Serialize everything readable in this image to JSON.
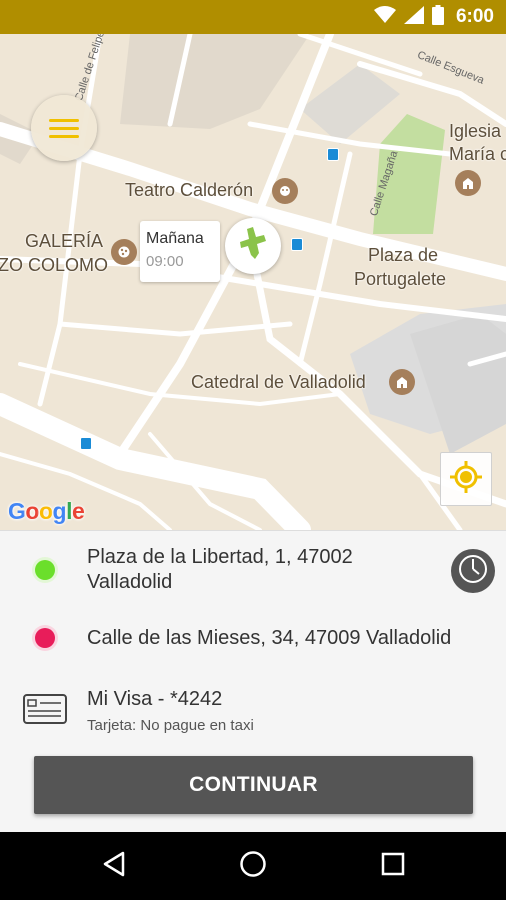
{
  "status_bar": {
    "time": "6:00",
    "icons": [
      "wifi-icon",
      "cell-signal-icon",
      "battery-icon"
    ]
  },
  "map": {
    "labels": {
      "teatro": "Teatro Calderón",
      "galeria_line1": "GALERÍA",
      "galeria_line2": "ZO COLOMO",
      "plaza_line1": "Plaza de",
      "plaza_line2": "Portugalete",
      "catedral": "Catedral de Valladolid",
      "iglesia_line1": "Iglesia",
      "iglesia_line2": "María c"
    },
    "streets": {
      "felipe": "Calle de Felipe II",
      "esgueva": "Calle Esgueva",
      "magana": "Calle Magaña"
    },
    "pickup_bubble": {
      "title": "Mañana",
      "time": "09:00"
    },
    "attribution": {
      "G": "G",
      "o1": "o",
      "o2": "o",
      "g": "g",
      "l": "l",
      "e": "e"
    }
  },
  "trip": {
    "origin_line1": "Plaza de la Libertad, 1, 47002",
    "origin_line2": "Valladolid",
    "destination": "Calle de las Mieses, 34, 47009 Valladolid",
    "payment_name": "Mi Visa - *4242",
    "payment_note": "Tarjeta: No pague en taxi"
  },
  "actions": {
    "continue_label": "CONTINUAR"
  },
  "colors": {
    "status_bar": "#b08e00",
    "menu_lines": "#f0c000",
    "origin_dot": "#6bdf2b",
    "destination_dot": "#e81d5a",
    "continue_bg": "#555555",
    "car_icon": "#8bc34a"
  },
  "nav_bar": {
    "icons": [
      "back-icon",
      "home-icon",
      "recents-icon"
    ]
  }
}
